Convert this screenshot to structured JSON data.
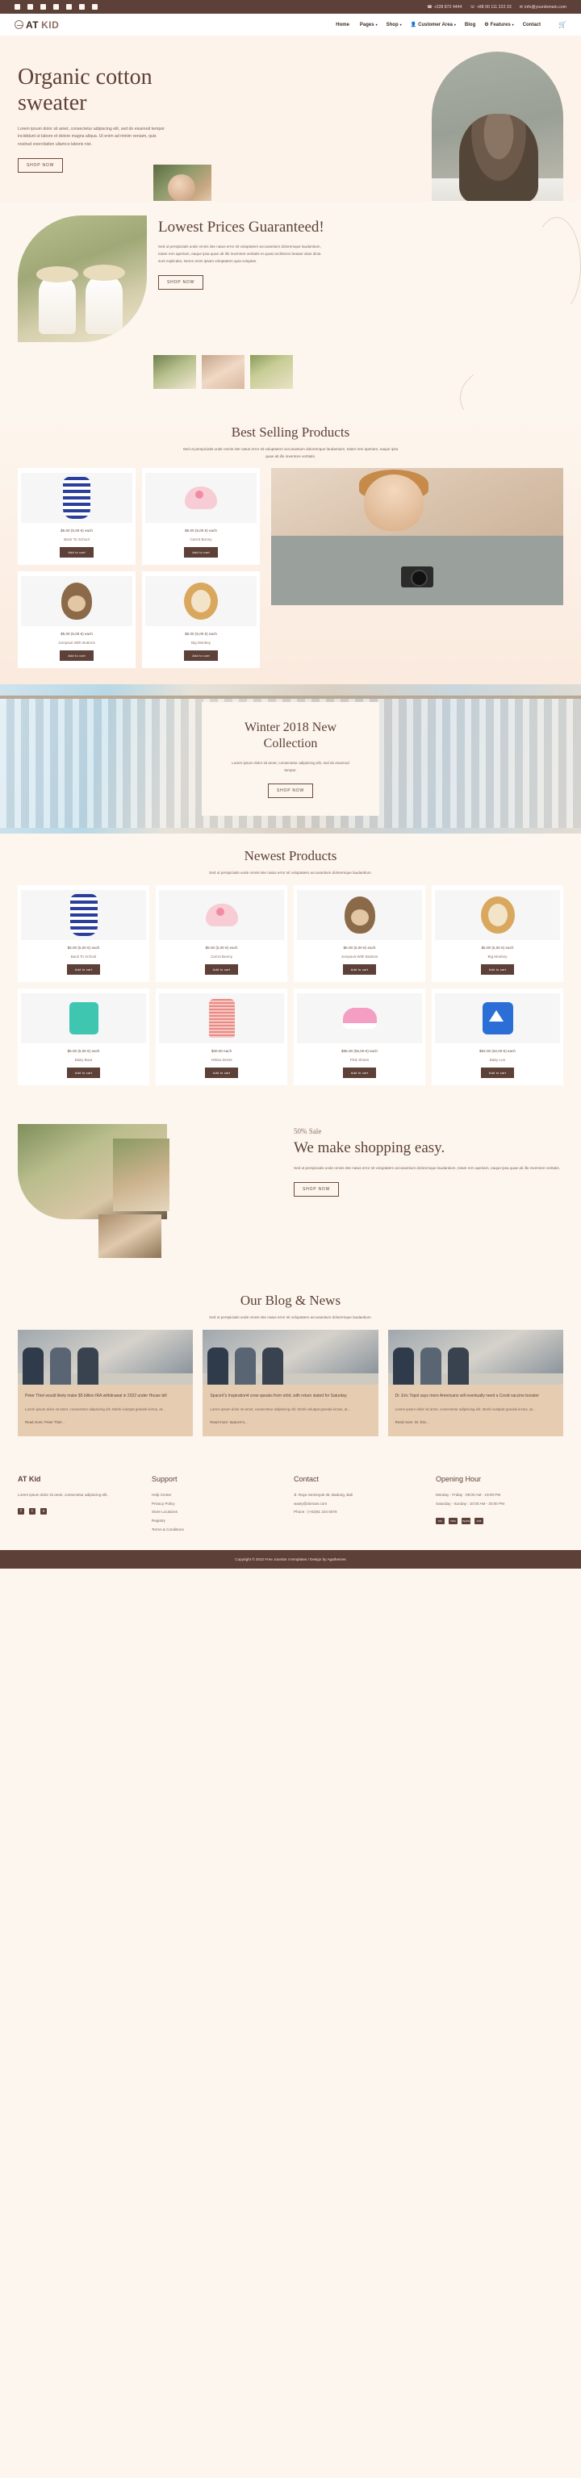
{
  "topbar": {
    "socials": [
      "facebook-icon",
      "twitter-icon",
      "pinterest-icon",
      "youtube-icon",
      "linkedin-icon",
      "instagram-icon",
      "flickr-icon"
    ],
    "phone1": "+228 872 4444",
    "phone2": "+88 00 111 222 33",
    "email": "info@yourdomain.com"
  },
  "header": {
    "brand_at": "AT",
    "brand_kid": "KID",
    "nav": [
      {
        "label": "Home",
        "caret": ""
      },
      {
        "label": "Pages",
        "caret": "▾"
      },
      {
        "label": "Shop",
        "caret": "▾"
      },
      {
        "label": "Customer Area",
        "caret": "▾"
      },
      {
        "label": "Blog",
        "caret": ""
      },
      {
        "label": "Features",
        "caret": "▾"
      },
      {
        "label": "Contact",
        "caret": ""
      }
    ],
    "cart_icon": "Ὥ2"
  },
  "hero": {
    "title": "Organic cotton sweater",
    "paragraph": "Lorem ipsum dolor sit amet, consectetur adipiscing elit, sed do eiusmod tempor incididunt ut labore et dolore magna aliqua. Ut enim ad minim veniam, quis nostrud exercitation ullamco laboris nisi.",
    "cta": "SHOP NOW"
  },
  "lowest": {
    "title": "Lowest Prices Guaranteed!",
    "paragraph": "Sed ut perspiciatis unde omnis iste natus error sit voluptatem accusantium doloremque laudantium, totam rem aperiam, eaque ipsa quae ab illo inventore veritatis et quasi architecto beatae vitae dicta sunt explicabo. Nemo enim ipsam voluptatem quia voluptas.",
    "cta": "SHOP NOW"
  },
  "best": {
    "title": "Best Selling Products",
    "subtitle": "Sed ut perspiciatis unde omnis iste natus error sit voluptatem accusantium doloremque laudantium, totam rem aperiam, eaque ipsa quae ab illo inventore veritatis.",
    "products": [
      {
        "price": "$5.00 (5,00 €) each",
        "name": "Back To School",
        "cta": "Add to cart",
        "art": "g-dress"
      },
      {
        "price": "$5.00 (5,00 €) each",
        "name": "Carrot Bunny",
        "cta": "Add to cart",
        "art": "g-bunny"
      },
      {
        "price": "$5.00 (5,00 €) each",
        "name": "Jumpsuit With Buttons",
        "cta": "Add to cart",
        "art": "g-monkey"
      },
      {
        "price": "$5.00 (5,00 €) each",
        "name": "Big Monkey",
        "cta": "Add to cart",
        "art": "g-lion"
      }
    ]
  },
  "winter": {
    "title": "Winter 2018 New Collection",
    "paragraph": "Lorem ipsum dolor sit amet, consectetur adipiscing elit, sed do eiusmod tempor.",
    "cta": "SHOP NOW"
  },
  "newest": {
    "title": "Newest Products",
    "subtitle": "Sed ut perspiciatis unde omnis iste natus error sit voluptatem accusantium doloremque laudantium.",
    "products": [
      {
        "price": "$5.00 (5,00 €) each",
        "name": "Back To School",
        "cta": "Add to cart",
        "art": "g-dress"
      },
      {
        "price": "$5.00 (5,00 €) each",
        "name": "Carrot Bunny",
        "cta": "Add to cart",
        "art": "g-bunny"
      },
      {
        "price": "$5.00 (5,00 €) each",
        "name": "Jumpsuit With Buttons",
        "cta": "Add to cart",
        "art": "g-monkey"
      },
      {
        "price": "$5.00 (5,00 €) each",
        "name": "Big Monkey",
        "cta": "Add to cart",
        "art": "g-lion"
      },
      {
        "price": "$5.00 (5,00 €) each",
        "name": "Baby Boat",
        "cta": "Add to cart",
        "art": "g-tee"
      },
      {
        "price": "$30.00 each",
        "name": "Yellow Dress",
        "cta": "Add to cart",
        "art": "g-ydress"
      },
      {
        "price": "$65.00 (65,00 €) each",
        "name": "Pink Shoes",
        "cta": "Add to cart",
        "art": "g-shoes"
      },
      {
        "price": "$62.00 (62,00 €) each",
        "name": "Baby Loo",
        "cta": "Add to cart",
        "art": "g-boat"
      }
    ]
  },
  "sale": {
    "eyebrow": "50% Sale",
    "title": "We make shopping easy.",
    "paragraph": "Sed ut perspiciatis unde omnis iste natus error sit voluptatem accusantium doloremque laudantium, totam rem aperiam, eaque ipsa quae ab illo inventore veritatis.",
    "cta": "SHOP NOW"
  },
  "blog": {
    "title": "Our Blog & News",
    "subtitle": "Sed ut perspiciatis unde omnis iste natus error sit voluptatem accusantium doloremque laudantium.",
    "posts": [
      {
        "title": "Peter Thiel would likely make $5 billion IRA withdrawal in 2022 under House bill",
        "excerpt": "Lorem ipsum dolor sit amet, consectetur adipiscing elit. Morbi volutpat gravida lectus, at...",
        "more": "Read more: Peter Thiel..."
      },
      {
        "title": "SpaceX's Inspiration4 crew speaks from orbit, with return slated for Saturday",
        "excerpt": "Lorem ipsum dolor sit amet, consectetur adipiscing elit. Morbi volutpat gravida lectus, at...",
        "more": "Read more: SpaceX's..."
      },
      {
        "title": "Dr. Eric Topol says more Americans will eventually need a Covid vaccine booster",
        "excerpt": "Lorem ipsum dolor sit amet, consectetur adipiscing elit. Morbi volutpat gravida lectus, at...",
        "more": "Read more: Dr. Eric..."
      }
    ]
  },
  "footer": {
    "brand": "AT Kid",
    "brand_text": "Lorem ipsum dolor sit amet, consectetur adipiscing elit.",
    "socials": [
      "f",
      "t",
      "v"
    ],
    "support_title": "Support",
    "support_links": [
      "Help Center",
      "Privacy Policy",
      "Store Locations",
      "Registry",
      "Terms & Conditions"
    ],
    "contact_title": "Contact",
    "address": "Jl. Raya Seminyak 36, Badung, Bali",
    "contact_email": "waxly@domain.com",
    "contact_phone": "Phone : (+62)81 234 5678",
    "hours_title": "Opening Hour",
    "hours": [
      "Monday - Friday : 09:00 AM - 19:00 PM",
      "Saturday - Sunday : 10:00 AM - 20:00 PM"
    ],
    "payments": [
      "MC",
      "VISA",
      "PayPal",
      "JCB"
    ],
    "copyright": "Copyright © 2022 Free Joomla! 4 templates / Design by Agathemes"
  }
}
